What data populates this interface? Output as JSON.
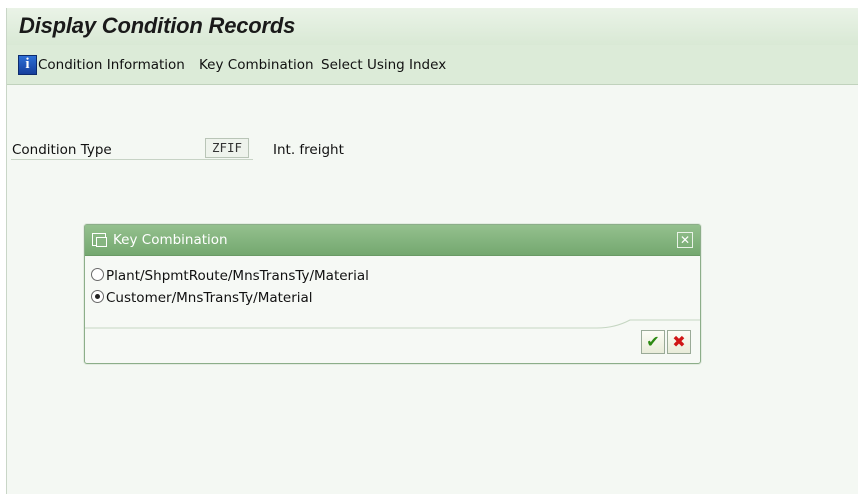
{
  "page": {
    "title": "Display Condition Records"
  },
  "toolbar": {
    "items": [
      {
        "label": "Condition Information",
        "icon": "info-icon"
      },
      {
        "label": "Key Combination"
      },
      {
        "label": "Select Using Index"
      }
    ]
  },
  "form": {
    "condition_type_label": "Condition Type",
    "condition_type_value": "ZFIF",
    "condition_type_desc": "Int. freight"
  },
  "dialog": {
    "title": "Key Combination",
    "close_glyph": "✕",
    "options": [
      {
        "label": "Plant/ShpmtRoute/MnsTransTy/Material",
        "selected": false
      },
      {
        "label": "Customer/MnsTransTy/Material",
        "selected": true
      }
    ],
    "ok_glyph": "✔",
    "cancel_glyph": "✖"
  },
  "colors": {
    "title_bar": "#dcebd8",
    "dialog_header": "#7fb07a",
    "ok_green": "#2d8a12",
    "cancel_red": "#d01616"
  }
}
